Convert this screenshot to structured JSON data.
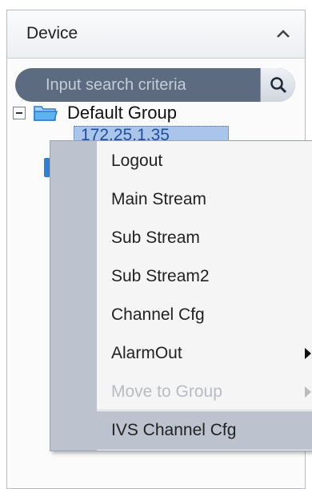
{
  "panel": {
    "title": "Device"
  },
  "search": {
    "placeholder": "Input search criteria"
  },
  "tree": {
    "group_label": "Default Group",
    "device_label": "172.25.1.35"
  },
  "context_menu": {
    "items": [
      {
        "label": "Logout",
        "enabled": true,
        "submenu": false
      },
      {
        "label": "Main Stream",
        "enabled": true,
        "submenu": false
      },
      {
        "label": "Sub Stream",
        "enabled": true,
        "submenu": false
      },
      {
        "label": "Sub Stream2",
        "enabled": true,
        "submenu": false
      },
      {
        "label": "Channel Cfg",
        "enabled": true,
        "submenu": false
      },
      {
        "label": "AlarmOut",
        "enabled": true,
        "submenu": true
      },
      {
        "label": "Move to Group",
        "enabled": false,
        "submenu": true
      },
      {
        "label": "IVS Channel Cfg",
        "enabled": true,
        "submenu": false
      }
    ]
  },
  "colors": {
    "search_bg": "#5c6b80",
    "selection": "#a9c6ea",
    "menu_gutter": "#bcc3cf"
  }
}
